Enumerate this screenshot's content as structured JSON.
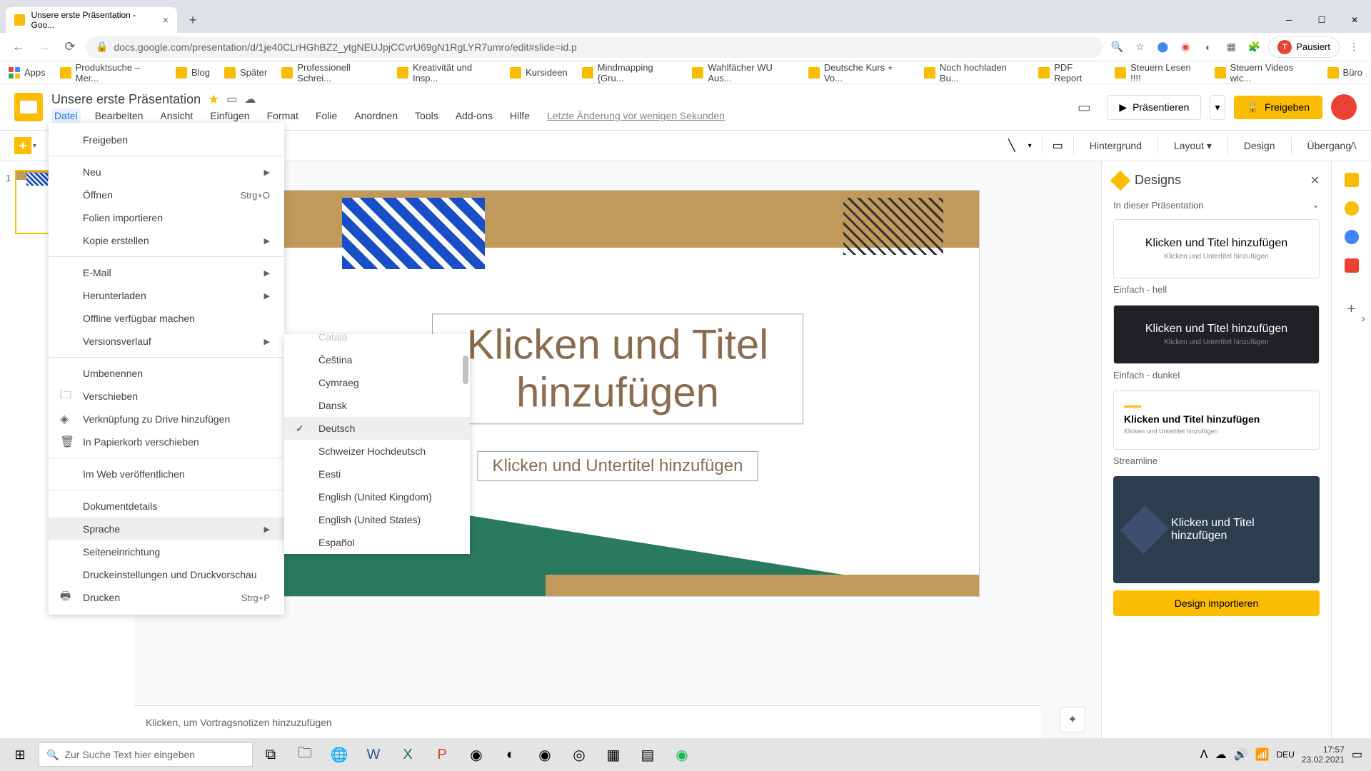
{
  "tab": {
    "title": "Unsere erste Präsentation - Goo..."
  },
  "browser": {
    "url": "docs.google.com/presentation/d/1je40CLrHGhBZ2_ytgNEUJpjCCvrU69gN1RgLYR7umro/edit#slide=id.p",
    "paused": "Pausiert"
  },
  "bookmarks": {
    "apps": "Apps",
    "items": [
      "Produktsuche – Mer...",
      "Blog",
      "Später",
      "Professionell Schrei...",
      "Kreativität und Insp...",
      "Kursideen",
      "Mindmapping {Gru...",
      "Wahlfächer WU Aus...",
      "Deutsche Kurs + Vo...",
      "Noch hochladen Bu...",
      "PDF Report",
      "Steuern Lesen !!!!",
      "Steuern Videos wic...",
      "Büro"
    ]
  },
  "doc": {
    "title": "Unsere erste Präsentation"
  },
  "menu": {
    "items": [
      "Datei",
      "Bearbeiten",
      "Ansicht",
      "Einfügen",
      "Format",
      "Folie",
      "Anordnen",
      "Tools",
      "Add-ons",
      "Hilfe"
    ],
    "last_edit": "Letzte Änderung vor wenigen Sekunden"
  },
  "header_buttons": {
    "present": "Präsentieren",
    "share": "Freigeben"
  },
  "toolbar": {
    "background": "Hintergrund",
    "layout": "Layout",
    "design": "Design",
    "transition": "Übergang"
  },
  "slide": {
    "title": "Klicken und Titel hinzufügen",
    "subtitle": "Klicken und Untertitel hinzufügen"
  },
  "notes": {
    "placeholder": "Klicken, um Vortragsnotizen hinzuzufügen"
  },
  "designs": {
    "title": "Designs",
    "subtitle": "In dieser Präsentation",
    "card1_title": "Klicken und Titel hinzufügen",
    "card1_sub": "Klicken und Untertitel hinzufügen",
    "label1": "Einfach - hell",
    "card2_title": "Klicken und Titel hinzufügen",
    "card2_sub": "Klicken und Untertitel hinzufügen",
    "label2": "Einfach - dunkel",
    "card3_title": "Klicken und Titel hinzufügen",
    "card3_sub": "Klicken und Untertitel hinzufügen",
    "label3": "Streamline",
    "card4_title": "Klicken und Titel hinzufügen",
    "import": "Design importieren"
  },
  "file_menu": {
    "share": "Freigeben",
    "new": "Neu",
    "open": "Öffnen",
    "open_sc": "Strg+O",
    "import": "Folien importieren",
    "copy": "Kopie erstellen",
    "email": "E-Mail",
    "download": "Herunterladen",
    "offline": "Offline verfügbar machen",
    "history": "Versionsverlauf",
    "rename": "Umbenennen",
    "move": "Verschieben",
    "drive": "Verknüpfung zu Drive hinzufügen",
    "trash": "In Papierkorb verschieben",
    "publish": "Im Web veröffentlichen",
    "details": "Dokumentdetails",
    "language": "Sprache",
    "page_setup": "Seiteneinrichtung",
    "print_settings": "Druckeinstellungen und Druckvorschau",
    "print": "Drucken",
    "print_sc": "Strg+P"
  },
  "lang_menu": {
    "items": [
      "Čeština",
      "Cymraeg",
      "Dansk",
      "Deutsch",
      "Schweizer Hochdeutsch",
      "Eesti",
      "English (United Kingdom)",
      "English (United States)",
      "Español"
    ],
    "selected_index": 3
  },
  "taskbar": {
    "search": "Zur Suche Text hier eingeben",
    "time": "17:57",
    "date": "23.02.2021",
    "lang": "DEU"
  }
}
